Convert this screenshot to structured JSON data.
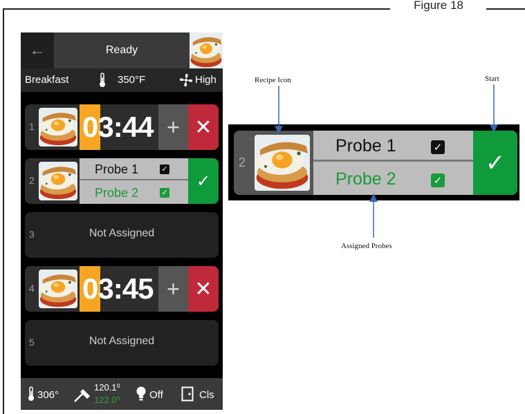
{
  "figure": {
    "title": "Figure 18"
  },
  "screen": {
    "status": "Ready",
    "recipe": "Breakfast",
    "temperature": "350°F",
    "fan_speed": "High",
    "slots": [
      {
        "number": "1",
        "timer": "03:44",
        "timer_accent": "0",
        "timer_rest": "3:44"
      },
      {
        "number": "2",
        "probe1": "Probe 1",
        "probe2": "Probe 2"
      },
      {
        "number": "3",
        "text": "Not Assigned"
      },
      {
        "number": "4",
        "timer": "03:45",
        "timer_accent": "0",
        "timer_rest": "3:45"
      },
      {
        "number": "5",
        "text": "Not Assigned"
      }
    ],
    "bottom": {
      "cavity_temp": "306°",
      "probe1_temp": "120.1⁰",
      "probe2_temp": "122.0⁰",
      "light": "Off",
      "door": "Cls"
    }
  },
  "callout": {
    "number": "2",
    "probe1": "Probe 1",
    "probe2": "Probe 2",
    "label_recipe_icon": "Recipe Icon",
    "label_start": "Start",
    "label_assigned_probes": "Assigned Probes"
  },
  "icons": {
    "back": "arrow-left-icon",
    "thermometer": "thermometer-icon",
    "fan": "fan-icon",
    "plus": "plus-icon",
    "cancel": "close-icon",
    "confirm": "checkmark-icon",
    "checkbox": "checkbox-checked-icon",
    "probe": "probe-icon",
    "light": "lightbulb-icon",
    "door": "door-icon"
  },
  "colors": {
    "timer_accent": "#f6a623",
    "cancel_red": "#c0293a",
    "confirm_green": "#0f9b3c",
    "probe2_green": "#1a9a3a",
    "probe_panel_gray": "#bdbdbd"
  }
}
